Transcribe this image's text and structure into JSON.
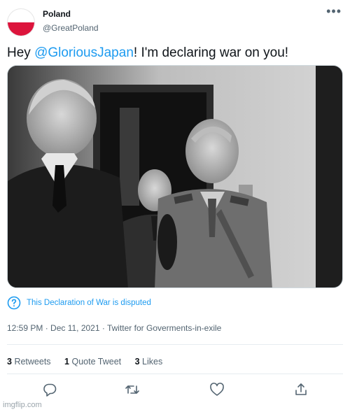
{
  "account": {
    "display_name": "Poland",
    "handle": "@GreatPoland",
    "avatar_colors": {
      "top": "#ffffff",
      "bottom": "#dc143c"
    }
  },
  "menu": {
    "more_icon": "more-horizontal-icon"
  },
  "tweet": {
    "text_before": "Hey ",
    "mention": "@GloriousJapan",
    "text_after": "! I'm declaring war on you!"
  },
  "photo": {
    "icon": "photo-image",
    "tone": "black-and-white"
  },
  "notice": {
    "icon": "info-circle-icon",
    "text": "This Declaration of War is disputed"
  },
  "meta": {
    "text": "12:59 PM · Dec 11, 2021 · Twitter for Goverments-in-exile"
  },
  "stats": {
    "retweets_count": "3",
    "retweets_label": "Retweets",
    "quotes_count": "1",
    "quotes_label": "Quote Tweet",
    "likes_count": "3",
    "likes_label": "Likes"
  },
  "actions": [
    "reply-icon",
    "retweet-icon",
    "like-icon",
    "share-icon"
  ],
  "watermark": "imgflip.com",
  "colors": {
    "accent": "#1d9bf0",
    "text": "#0f1419",
    "muted": "#536471",
    "border": "#e6ecf0"
  }
}
